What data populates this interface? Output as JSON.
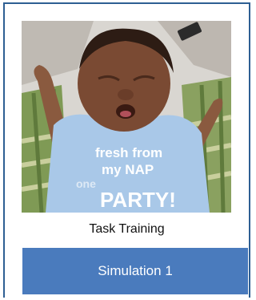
{
  "card": {
    "photo_alt": "sleeping baby wearing a blue onesie",
    "shirt_text": [
      "fresh from",
      "my NAP",
      "one",
      "PARTY!"
    ],
    "caption": "Task Training",
    "button_label": "Simulation 1"
  },
  "colors": {
    "border": "#2e5f93",
    "button_bg": "#4a7bbd",
    "button_text": "#ffffff"
  }
}
